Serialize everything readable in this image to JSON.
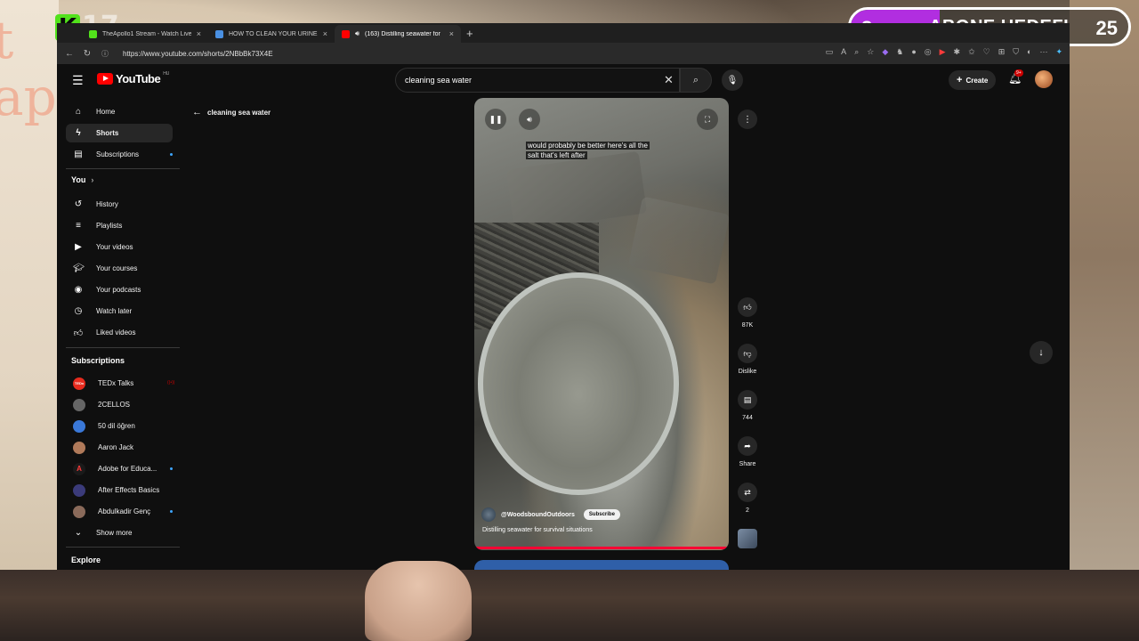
{
  "stream": {
    "viewer_count": "17",
    "goal": {
      "current": "8",
      "label": "ABONE HEDEFI",
      "target": "25",
      "progress": 0.32,
      "color": "#b12ee0"
    },
    "brand_color": "#52e21b"
  },
  "browser": {
    "tabs": [
      {
        "title": "TheApollo1 Stream - Watch Live",
        "active": false,
        "favicon_color": "#52e21b"
      },
      {
        "title": "HOW TO CLEAN YOUR URINE to",
        "active": false,
        "favicon_color": "#4a90e2"
      },
      {
        "title": "(163) Distilling seawater for",
        "active": true,
        "favicon_color": "#ff0000"
      }
    ],
    "url": "https://www.youtube.com/shorts/2NBbBk73X4E"
  },
  "youtube": {
    "logo_text": "YouTube",
    "region": "HU",
    "search_query": "cleaning sea water",
    "create_label": "Create",
    "notifications": "9+",
    "sidebar": {
      "main": [
        {
          "label": "Home",
          "icon": "home-icon"
        },
        {
          "label": "Shorts",
          "icon": "shorts-icon",
          "active": true
        },
        {
          "label": "Subscriptions",
          "icon": "subscriptions-icon"
        }
      ],
      "you_heading": "You",
      "you_items": [
        {
          "label": "History",
          "icon": "history-icon"
        },
        {
          "label": "Playlists",
          "icon": "playlists-icon"
        },
        {
          "label": "Your videos",
          "icon": "your-videos-icon"
        },
        {
          "label": "Your courses",
          "icon": "courses-icon"
        },
        {
          "label": "Your podcasts",
          "icon": "podcasts-icon"
        },
        {
          "label": "Watch later",
          "icon": "watch-later-icon"
        },
        {
          "label": "Liked videos",
          "icon": "liked-icon"
        }
      ],
      "subscriptions_heading": "Subscriptions",
      "subscriptions": [
        {
          "label": "TEDx Talks",
          "avatar_color": "#e62b1e",
          "avatar_text": "TEDx"
        },
        {
          "label": "2CELLOS",
          "avatar_color": "#666666"
        },
        {
          "label": "50 dil öğren",
          "avatar_color": "#3a78d8"
        },
        {
          "label": "Aaron Jack",
          "avatar_color": "#b07a5a"
        },
        {
          "label": "Adobe for Educa...",
          "avatar_color": "#1a1a1a"
        },
        {
          "label": "After Effects Basics",
          "avatar_color": "#3b3b7a"
        },
        {
          "label": "Abdulkadir Genç",
          "avatar_color": "#8a6a5a"
        }
      ],
      "show_more": "Show more",
      "explore_heading": "Explore"
    },
    "back_query": "cleaning sea water",
    "short": {
      "caption_line1": "would probably be better here's all the",
      "caption_line2": "salt that's left after",
      "channel": "@WoodsboundOutdoors",
      "subscribe": "Subscribe",
      "title": "Distilling seawater for survival situations",
      "progress": 1.0,
      "likes": "87K",
      "dislike": "Dislike",
      "comments": "744",
      "share": "Share",
      "remix": "2"
    }
  }
}
